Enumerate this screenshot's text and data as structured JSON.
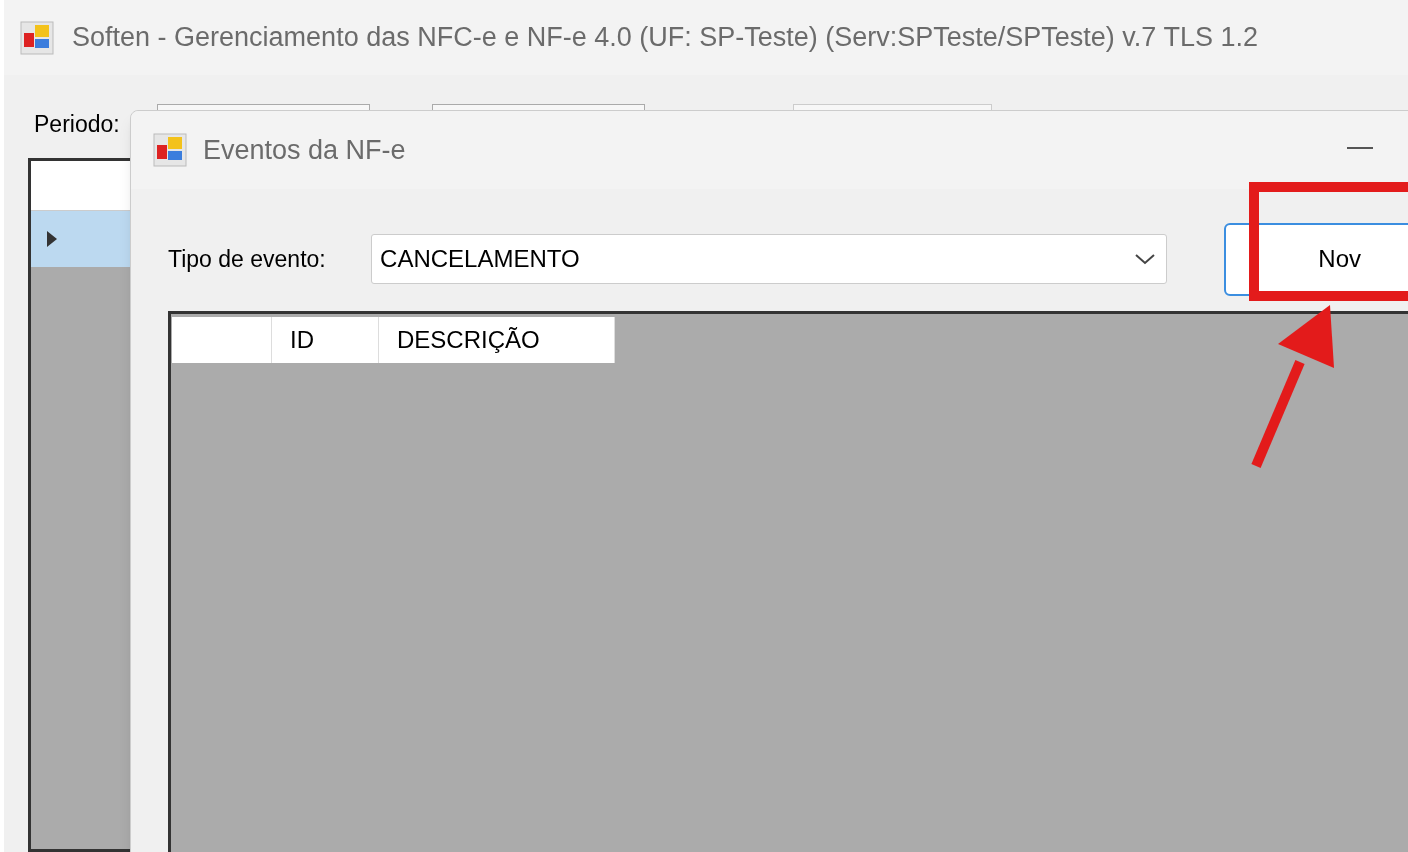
{
  "main_window": {
    "title": "Soften - Gerenciamento das NFC-e e NF-e 4.0 (UF: SP-Teste) (Serv:SPTeste/SPTeste) v.7 TLS 1.2",
    "period_label": "Periodo:",
    "grid_rows": [
      {
        "selected": true
      }
    ]
  },
  "dialog": {
    "title": "Eventos da NF-e",
    "event_type_label": "Tipo de evento:",
    "event_type_value": "CANCELAMENTO",
    "new_button": "Nov",
    "columns": [
      "",
      "ID",
      "DESCRIÇÃO"
    ]
  }
}
